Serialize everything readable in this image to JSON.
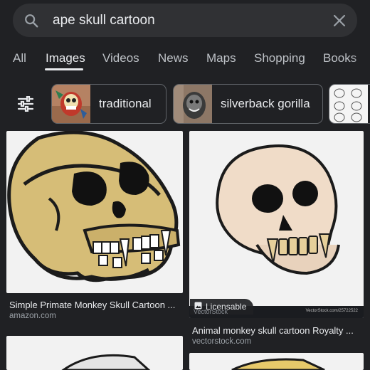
{
  "search": {
    "query": "ape skull cartoon"
  },
  "tabs": [
    {
      "label": "All",
      "active": false
    },
    {
      "label": "Images",
      "active": true
    },
    {
      "label": "Videos",
      "active": false
    },
    {
      "label": "News",
      "active": false
    },
    {
      "label": "Maps",
      "active": false
    },
    {
      "label": "Shopping",
      "active": false
    },
    {
      "label": "Books",
      "active": false
    }
  ],
  "chips": [
    {
      "label": "traditional"
    },
    {
      "label": "silverback gorilla"
    }
  ],
  "results": [
    {
      "title": "Simple Primate Monkey Skull Cartoon ...",
      "source": "amazon.com"
    },
    {
      "title": "Animal monkey skull cartoon Royalty ...",
      "source": "vectorstock.com",
      "badge": "Licensable",
      "watermark": "VectorStock",
      "footer_text": "VectorStock.com/25722522"
    }
  ],
  "icons": {
    "search": "search-icon",
    "clear": "close-icon",
    "filters": "tune-icon",
    "badge": "licensable-icon"
  },
  "colors": {
    "background": "#202124",
    "search_bar": "#303134",
    "text": "#e8eaed",
    "muted": "#9aa0a6"
  }
}
